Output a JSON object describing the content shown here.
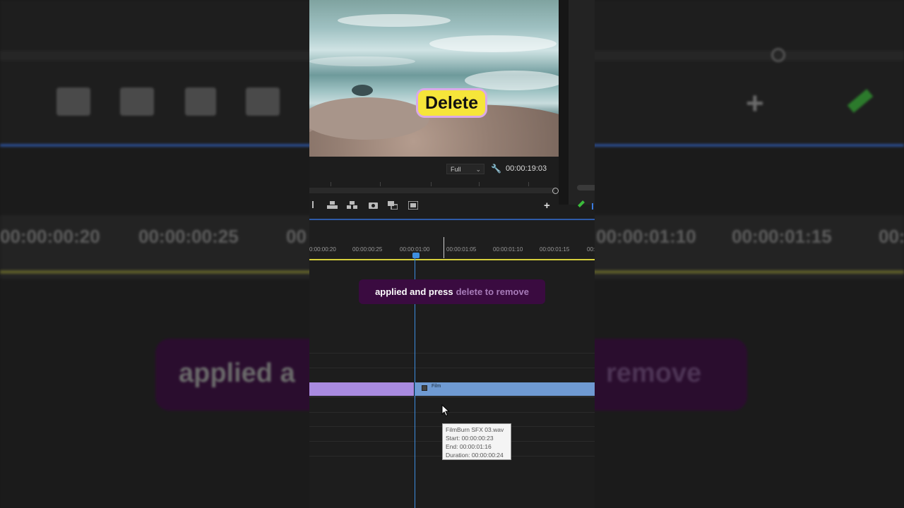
{
  "overlay": {
    "sticker_text": "Delete",
    "caption_white": "applied and press",
    "caption_purple": "delete to remove",
    "bg_caption_left": "applied a",
    "bg_caption_right": "remove"
  },
  "program_monitor": {
    "quality": "Full",
    "timecode": "00:00:19:03"
  },
  "timeline": {
    "ruler_labels": [
      "0:00:00:20",
      "00:00:00:25",
      "00:00:01:00",
      "00:00:01:05",
      "00:00:01:10",
      "00:00:01:15",
      "00:"
    ],
    "bg_ruler_labels": [
      "00:00:00:20",
      "00:00:00:25",
      "00",
      "00:00:01:10",
      "00:00:01:15",
      "00:"
    ],
    "clip_name": "Film"
  },
  "tooltip": {
    "file": "FilmBurn SFX 03.wav",
    "start": "Start: 00:00:00:23",
    "end": "End: 00:00:01:16",
    "duration": "Duration: 00:00:00:24"
  },
  "colors": {
    "caption_bg": "#3a0b40",
    "caption_highlight": "#a77bb8",
    "sticker_yellow": "#f6e53a",
    "clip_purple": "#a98be0",
    "clip_blue": "#6f9ad2",
    "playhead": "#3d8ee0",
    "ruler_yellow": "#d6cf3c"
  }
}
